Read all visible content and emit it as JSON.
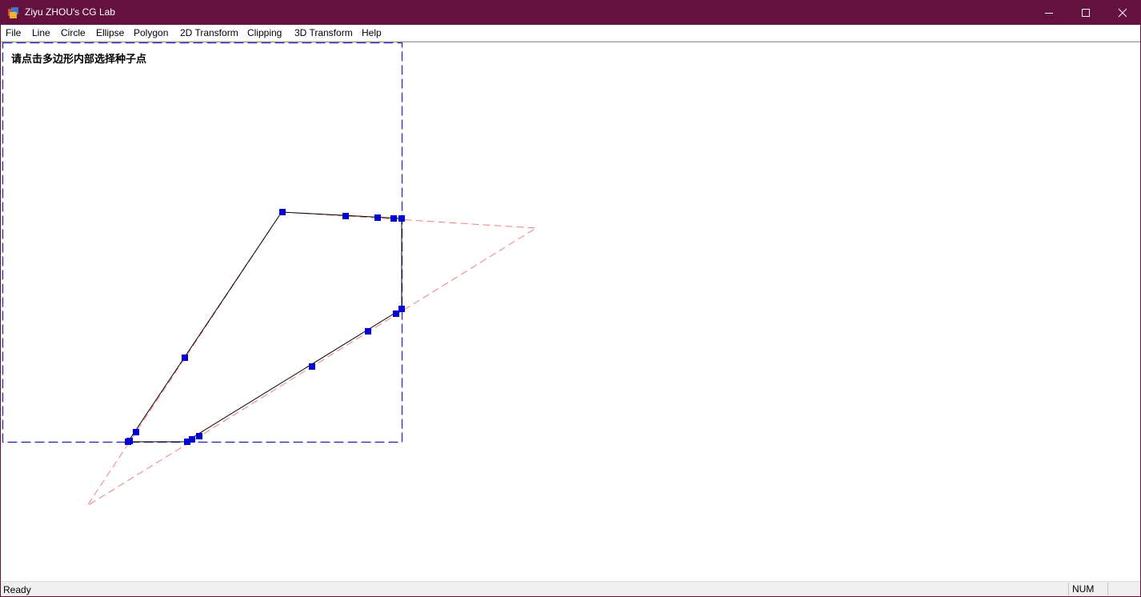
{
  "window": {
    "title": "Ziyu ZHOU's CG Lab",
    "icon": "app-icon",
    "controls": [
      "minimize-icon",
      "maximize-icon",
      "close-icon"
    ],
    "title_bar_color": "#64113f"
  },
  "menu": {
    "items": [
      {
        "label": "File"
      },
      {
        "label": "Line"
      },
      {
        "label": "Circle"
      },
      {
        "label": "Ellipse"
      },
      {
        "label": "Polygon"
      },
      {
        "label": "2D Transform"
      },
      {
        "label": "Clipping"
      },
      {
        "label": "3D Transform"
      },
      {
        "label": "Help"
      }
    ]
  },
  "canvas": {
    "prompt": "请点击多边形内部选择种子点",
    "colors": {
      "clip_window": "#1f1fb0",
      "original_polygon": "#f08080",
      "clipped_polygon": "#000000",
      "vertex_marker": "#0000d0"
    }
  },
  "status": {
    "left": "Ready",
    "indicator": "NUM"
  }
}
